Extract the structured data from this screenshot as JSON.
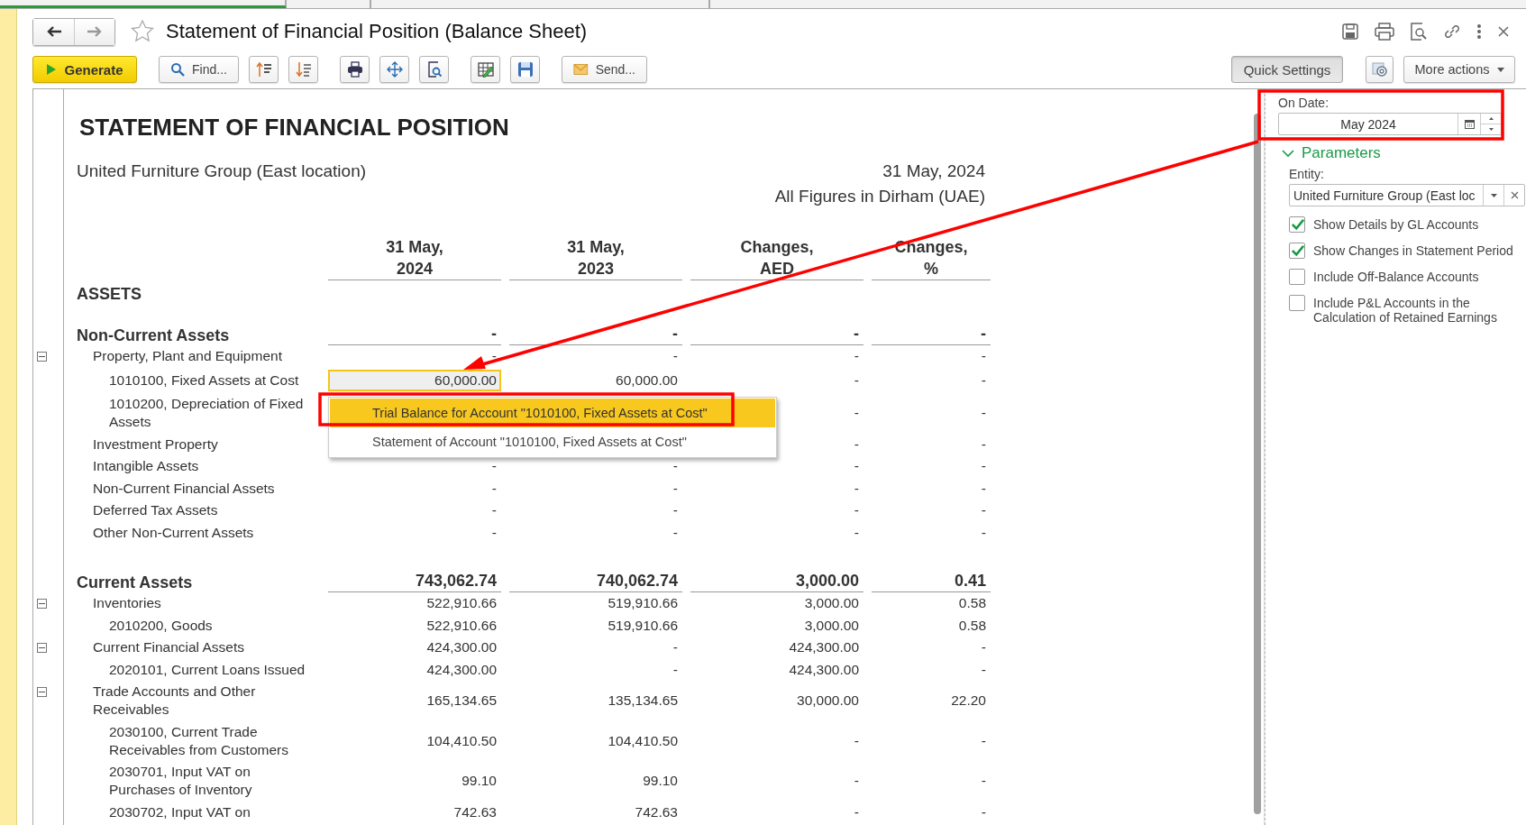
{
  "tab_strip": [
    {
      "selected": true
    },
    {
      "selected": false
    },
    {
      "selected": false
    }
  ],
  "header": {
    "title": "Statement of Financial Position (Balance Sheet)",
    "favorite": false
  },
  "toolbar": {
    "generate": "Generate",
    "find": "Find...",
    "send": "Send...",
    "quick_settings": {
      "label": "Quick Settings",
      "pressed": true
    },
    "more_actions": "More actions"
  },
  "report": {
    "title": "STATEMENT OF FINANCIAL POSITION",
    "company": "United Furniture Group (East location)",
    "date": "31 May, 2024",
    "currency_note": "All Figures in Dirham (UAE)",
    "columns": [
      "31 May,\n2024",
      "31 May,\n2023",
      "Changes,\nAED",
      "Changes,\n%"
    ],
    "rows": [
      {
        "kind": "heading",
        "label": "ASSETS",
        "selected": false
      },
      {
        "kind": "section",
        "label": "Non-Current Assets",
        "selected": false,
        "cells": [
          "-",
          "-",
          "-",
          "-"
        ],
        "children": [
          {
            "label": "Property, Plant and Equipment",
            "expanded": true,
            "selected": false,
            "cells": [
              "-",
              "-",
              "-",
              "-"
            ],
            "children": [
              {
                "label": "1010100, Fixed Assets at Cost",
                "selected": true,
                "cells": [
                  "60,000.00",
                  "60,000.00",
                  "-",
                  "-"
                ]
              },
              {
                "label": "1010200, Depreciation of Fixed Assets",
                "selected": false,
                "cells": [
                  null,
                  null,
                  "-",
                  "-"
                ]
              }
            ]
          },
          {
            "label": "Investment Property",
            "selected": false,
            "cells": [
              null,
              null,
              "-",
              "-"
            ]
          },
          {
            "label": "Intangible Assets",
            "selected": false,
            "cells": [
              "-",
              "-",
              "-",
              "-"
            ]
          },
          {
            "label": "Non-Current Financial Assets",
            "selected": false,
            "cells": [
              "-",
              "-",
              "-",
              "-"
            ]
          },
          {
            "label": "Deferred Tax Assets",
            "selected": false,
            "cells": [
              "-",
              "-",
              "-",
              "-"
            ]
          },
          {
            "label": "Other Non-Current Assets",
            "selected": false,
            "cells": [
              "-",
              "-",
              "-",
              "-"
            ]
          }
        ]
      },
      {
        "kind": "section",
        "label": "Current Assets",
        "selected": false,
        "cells": [
          "743,062.74",
          "740,062.74",
          "3,000.00",
          "0.41"
        ],
        "children": [
          {
            "label": "Inventories",
            "expanded": true,
            "selected": false,
            "cells": [
              "522,910.66",
              "519,910.66",
              "3,000.00",
              "0.58"
            ],
            "children": [
              {
                "label": "2010200, Goods",
                "selected": false,
                "cells": [
                  "522,910.66",
                  "519,910.66",
                  "3,000.00",
                  "0.58"
                ]
              }
            ]
          },
          {
            "label": "Current Financial Assets",
            "expanded": true,
            "selected": false,
            "cells": [
              "424,300.00",
              "-",
              "424,300.00",
              "-"
            ],
            "children": [
              {
                "label": "2020101, Current Loans Issued",
                "selected": false,
                "cells": [
                  "424,300.00",
                  "-",
                  "424,300.00",
                  "-"
                ]
              }
            ]
          },
          {
            "label": "Trade Accounts and Other Receivables",
            "expanded": true,
            "selected": false,
            "cells": [
              "165,134.65",
              "135,134.65",
              "30,000.00",
              "22.20"
            ],
            "children": [
              {
                "label": "2030100, Current Trade Receivables from Customers",
                "selected": false,
                "cells": [
                  "104,410.50",
                  "104,410.50",
                  "-",
                  "-"
                ]
              },
              {
                "label": "2030701, Input VAT on Purchases of Inventory",
                "selected": false,
                "cells": [
                  "99.10",
                  "99.10",
                  "-",
                  "-"
                ]
              },
              {
                "label": "2030702, Input VAT on",
                "selected": false,
                "cells": [
                  "742.63",
                  "742.63",
                  "-",
                  "-"
                ]
              }
            ]
          }
        ]
      }
    ]
  },
  "context_menu": {
    "items": [
      {
        "label": "Trial Balance for Account \"1010100, Fixed Assets at Cost\"",
        "selected": true
      },
      {
        "label": "Statement of Account \"1010100, Fixed Assets at Cost\"",
        "selected": false
      }
    ]
  },
  "settings_panel": {
    "on_date": {
      "label": "On Date:",
      "value": "May 2024"
    },
    "parameters": {
      "title": "Parameters",
      "expanded": true,
      "entity": {
        "label": "Entity:",
        "value": "United Furniture Group (East loc"
      },
      "options": [
        {
          "label": "Show Details by GL Accounts",
          "checked": true
        },
        {
          "label": "Show Changes in Statement Period",
          "checked": true
        },
        {
          "label": "Include Off-Balance Accounts",
          "checked": false
        },
        {
          "label": "Include P&L Accounts in the Calculation of Retained Earnings",
          "checked": false
        }
      ]
    }
  }
}
